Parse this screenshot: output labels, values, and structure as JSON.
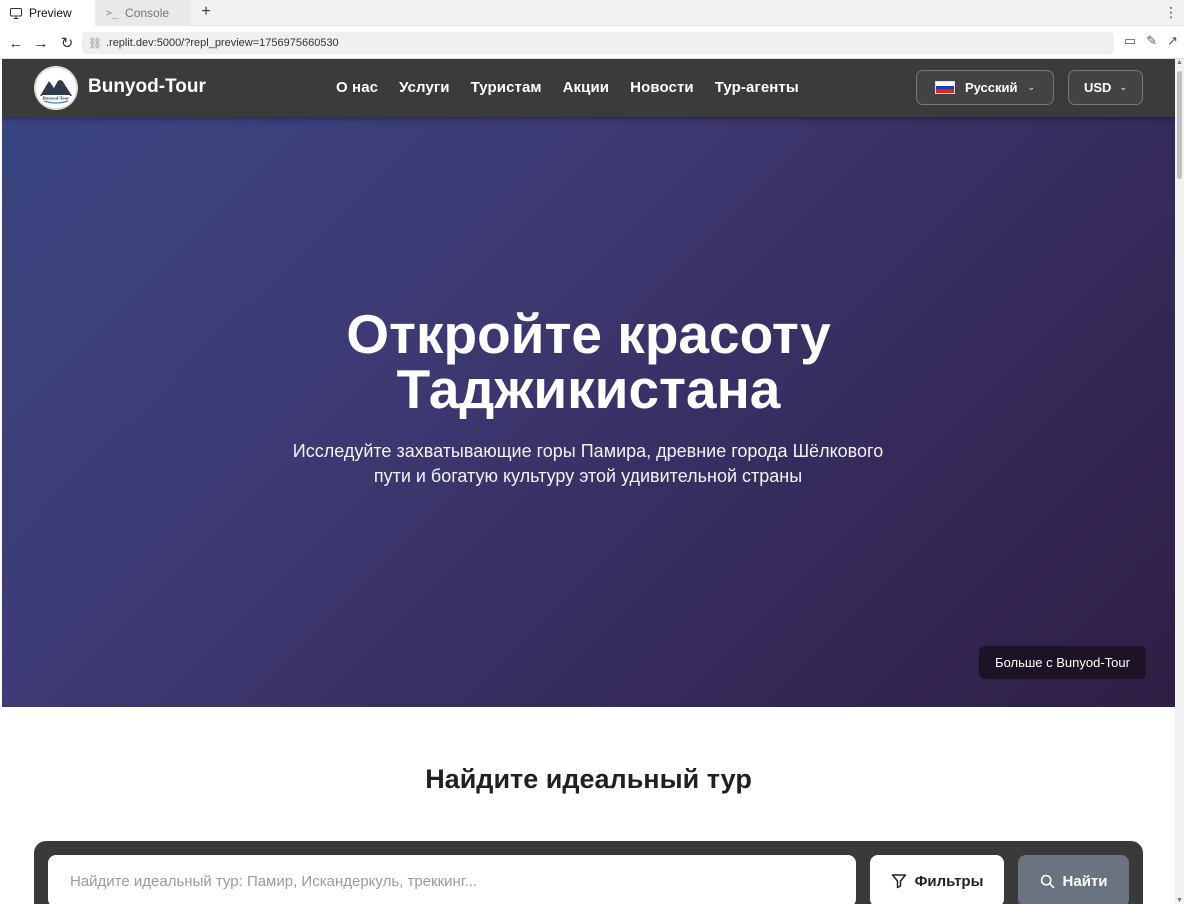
{
  "browser": {
    "tabs": [
      {
        "label": "Preview",
        "icon": "monitor-icon"
      },
      {
        "label": "Console",
        "icon": "terminal-icon"
      }
    ],
    "new_tab_label": "+",
    "url": ".replit.dev:5000/?repl_preview=1756975660530"
  },
  "site": {
    "brand": "Bunyod-Tour",
    "logo_text": "Bunyod-Tour",
    "nav": [
      "О нас",
      "Услуги",
      "Туристам",
      "Акции",
      "Новости",
      "Тур-агенты"
    ],
    "language": {
      "label": "Русский",
      "flag_colors": [
        "#ffffff",
        "#1c3fb0",
        "#d52b1e"
      ]
    },
    "currency": {
      "label": "USD"
    }
  },
  "hero": {
    "title_line1": "Откройте красоту",
    "title_line2": "Таджикистана",
    "subtitle": "Исследуйте захватывающие горы Памира, древние города Шёлкового пути и богатую культуру этой удивительной страны",
    "more_button": "Больше с Bunyod-Tour"
  },
  "search": {
    "title": "Найдите идеальный тур",
    "placeholder": "Найдите идеальный тур: Памир, Искандеркуль, треккинг...",
    "filters_label": "Фильтры",
    "find_label": "Найти"
  },
  "colors": {
    "header_bg": "#3b3b3b",
    "hero_gradient_start": "#3b4583",
    "hero_gradient_end": "#2e1f44",
    "find_button": "#6b7280"
  }
}
